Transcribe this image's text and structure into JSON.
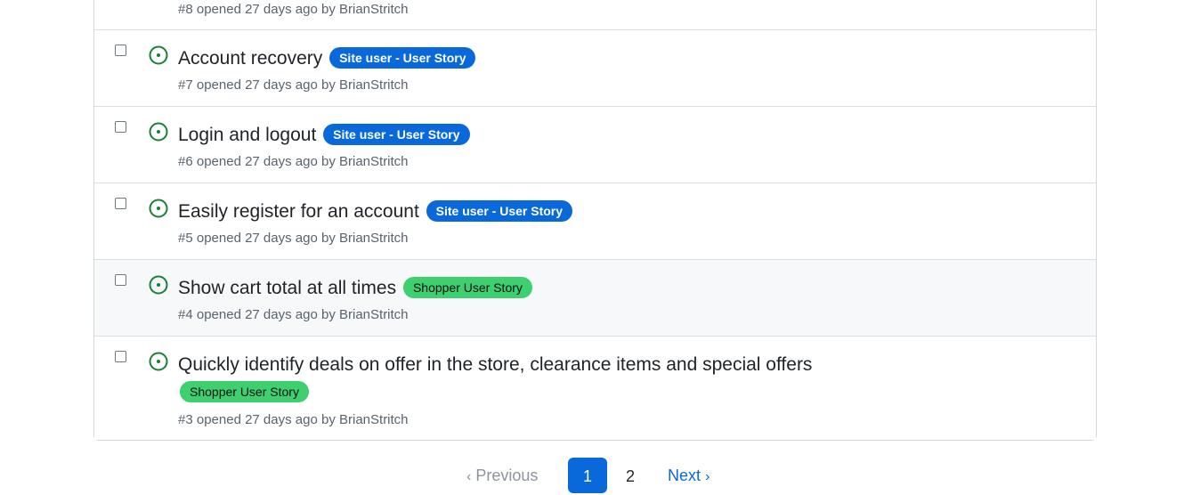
{
  "issues": [
    {
      "number_text": "#8",
      "opened": "opened 27 days ago by",
      "author": "BrianStritch"
    },
    {
      "title": "Account recovery",
      "label": "Site user - User Story",
      "number_text": "#7",
      "opened": "opened 27 days ago by",
      "author": "BrianStritch"
    },
    {
      "title": "Login and logout",
      "label": "Site user - User Story",
      "number_text": "#6",
      "opened": "opened 27 days ago by",
      "author": "BrianStritch"
    },
    {
      "title": "Easily register for an account",
      "label": "Site user - User Story",
      "number_text": "#5",
      "opened": "opened 27 days ago by",
      "author": "BrianStritch"
    },
    {
      "title": "Show cart total at all times",
      "label": "Shopper User Story",
      "number_text": "#4",
      "opened": "opened 27 days ago by",
      "author": "BrianStritch"
    },
    {
      "title": "Quickly identify deals on offer in the store, clearance items and special offers",
      "label": "Shopper User Story",
      "number_text": "#3",
      "opened": "opened 27 days ago by",
      "author": "BrianStritch"
    }
  ],
  "labels": {
    "site_user": {
      "color": "#0969da"
    },
    "shopper": {
      "color": "#3ecf6e"
    }
  },
  "status_icon": "issue-opened-icon",
  "status_color": "#1a7f37",
  "pagination": {
    "previous": "Previous",
    "pages": [
      "1",
      "2"
    ],
    "current": "1",
    "next": "Next"
  }
}
